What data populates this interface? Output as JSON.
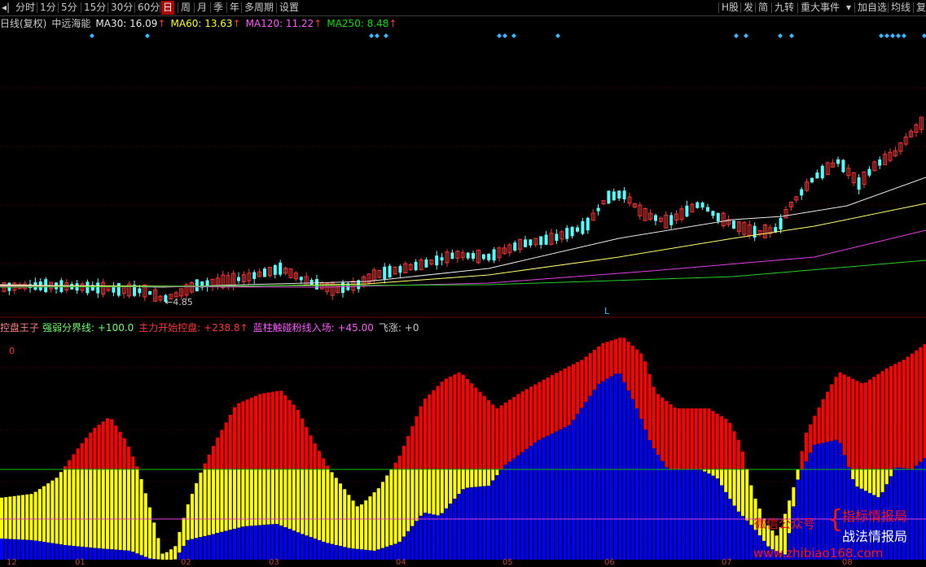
{
  "toolbar": {
    "left": [
      "分时",
      "1分",
      "5分",
      "15分",
      "30分",
      "60分",
      "日",
      "周",
      "月",
      "季",
      "年",
      "多周期",
      "设置"
    ],
    "active": "日",
    "right": [
      "H股",
      "发",
      "简",
      "九转",
      "重大事件",
      "加自选",
      "均线",
      "复"
    ]
  },
  "main_info": {
    "period": "日线(复权)",
    "name": "中远海能",
    "ma30": "MA30: 16.09",
    "ma60": "MA60: 13.63",
    "ma120": "MA120: 11.22",
    "ma250": "MA250: 8.48",
    "arrow": "↑",
    "low_label": "4.85",
    "l_marker": "L"
  },
  "indicator_info": {
    "name": "控盘王子",
    "line1": "强弱分界线: +100.0",
    "line2": "主力开始控盘: +238.8↑",
    "line3": "蓝柱触碰粉线入场: +45.00",
    "line4": "飞涨: +0",
    "zero_label": "0"
  },
  "axis": {
    "ticks": [
      "12",
      "01",
      "02",
      "03",
      "04",
      "05",
      "06",
      "07",
      "08"
    ]
  },
  "watermark": {
    "left": "微信公众号",
    "right1": "指标情报局",
    "right2": "战法情报局",
    "site": "www.zhibiao168.com"
  },
  "colors": {
    "bg": "#000000",
    "up": "#ff3232",
    "down": "#54ffff",
    "ma30": "#ffffff",
    "ma60": "#ffff00",
    "ma120": "#ff00ff",
    "ma250": "#00ff00",
    "red_bar": "#ff0000",
    "yellow_bar": "#ffff00",
    "blue_bar": "#0000ff"
  },
  "chart_data": [
    {
      "type": "candlestick",
      "title": "中远海能",
      "series": [
        {
          "name": "MA30",
          "value": 16.09
        },
        {
          "name": "MA60",
          "value": 13.63
        },
        {
          "name": "MA120",
          "value": 11.22
        },
        {
          "name": "MA250",
          "value": 8.48
        }
      ],
      "low": 4.85
    },
    {
      "type": "bar",
      "title": "控盘王子",
      "series": [
        {
          "name": "强弱分界线",
          "value": 100.0
        },
        {
          "name": "主力开始控盘",
          "value": 238.8
        },
        {
          "name": "蓝柱触碰粉线入场",
          "value": 45.0
        },
        {
          "name": "飞涨",
          "value": 0
        }
      ],
      "ylim": [
        0,
        300
      ]
    }
  ]
}
